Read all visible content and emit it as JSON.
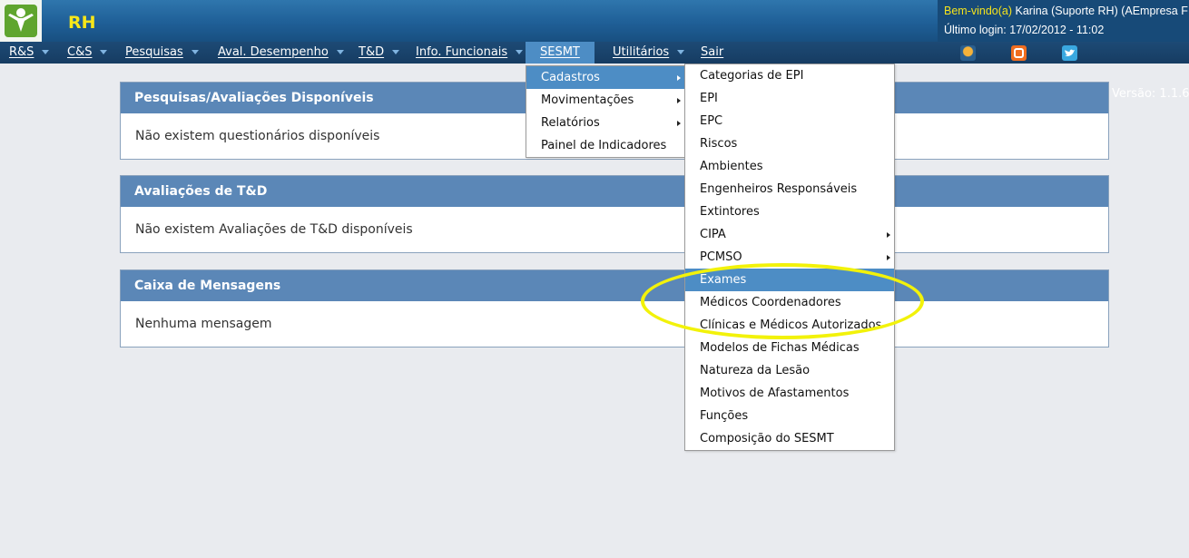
{
  "app": {
    "title": "RH"
  },
  "user": {
    "welcome_label": "Bem-vindo(a)",
    "user_text": " Karina (Suporte RH) (AEmpresa F",
    "last_login": "Último login: 17/02/2012 - 11:02"
  },
  "menu": {
    "items": [
      {
        "label": "R&S"
      },
      {
        "label": "C&S"
      },
      {
        "label": "Pesquisas"
      },
      {
        "label": "Aval. Desempenho"
      },
      {
        "label": "T&D"
      },
      {
        "label": "Info. Funcionais"
      },
      {
        "label": "SESMT"
      },
      {
        "label": "Utilitários"
      },
      {
        "label": "Sair"
      }
    ],
    "version": "Versão: 1.1.6"
  },
  "icons": {
    "app_logo": "person-logo-icon",
    "quote": "award-icon",
    "blog": "blogger-icon",
    "twitter": "twitter-icon"
  },
  "panels": [
    {
      "title": "Pesquisas/Avaliações Disponíveis",
      "body": "Não existem questionários disponíveis"
    },
    {
      "title": "Avaliações de T&D",
      "body": "Não existem Avaliações de T&D disponíveis"
    },
    {
      "title": "Caixa de Mensagens",
      "body": "Nenhuma mensagem"
    }
  ],
  "sesmt_menu": {
    "items": [
      {
        "label": "Cadastros"
      },
      {
        "label": "Movimentações"
      },
      {
        "label": "Relatórios"
      },
      {
        "label": "Painel de Indicadores"
      }
    ]
  },
  "cadastros_menu": {
    "items": [
      {
        "label": "Categorias de EPI"
      },
      {
        "label": "EPI"
      },
      {
        "label": "EPC"
      },
      {
        "label": "Riscos"
      },
      {
        "label": "Ambientes"
      },
      {
        "label": "Engenheiros Responsáveis"
      },
      {
        "label": "Extintores"
      },
      {
        "label": "CIPA"
      },
      {
        "label": "PCMSO"
      },
      {
        "label": "Exames"
      },
      {
        "label": "Médicos Coordenadores"
      },
      {
        "label": "Clínicas e Médicos Autorizados"
      },
      {
        "label": "Modelos de Fichas Médicas"
      },
      {
        "label": "Natureza da Lesão"
      },
      {
        "label": "Motivos de Afastamentos"
      },
      {
        "label": "Funções"
      },
      {
        "label": "Composição do SESMT"
      }
    ]
  },
  "colors": {
    "header": "#1f5f97",
    "menubar": "#1d4a75",
    "highlight": "#4d8dc5",
    "panel_header": "#5b87b7",
    "title_yellow": "#f7e619",
    "annotation_yellow": "#f2f20a"
  }
}
